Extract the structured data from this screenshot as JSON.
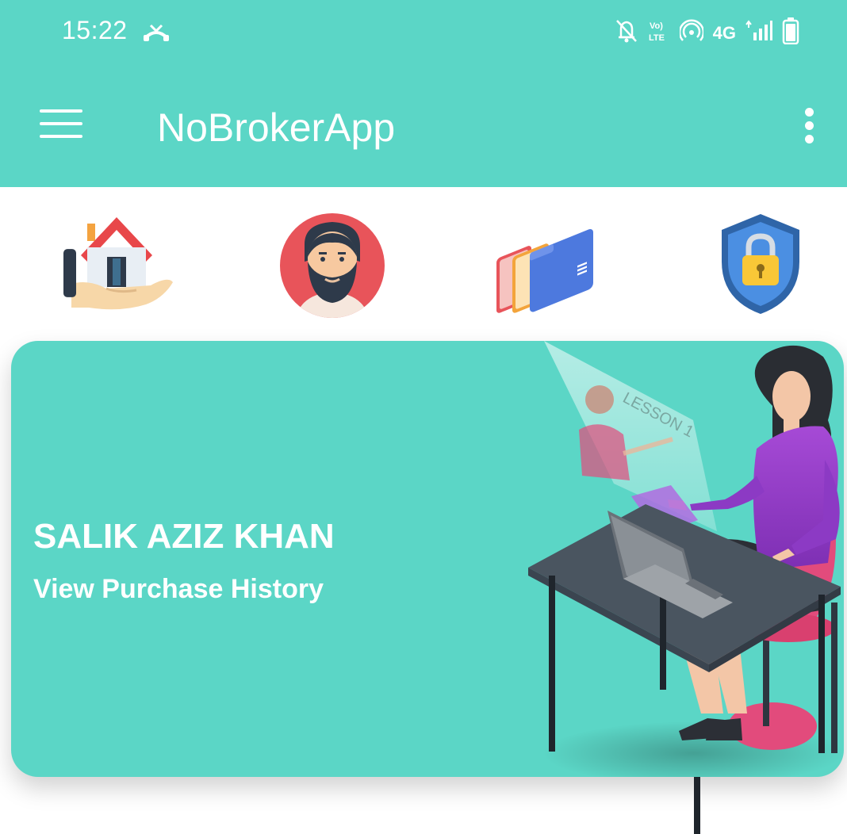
{
  "status_bar": {
    "time": "15:22",
    "network": "4G",
    "icons": [
      "missed-call-icon",
      "bell-off-icon",
      "volte-icon",
      "hotspot-icon",
      "signal-icon",
      "battery-icon"
    ]
  },
  "toolbar": {
    "title": "NoBrokerApp",
    "menu_icon": "hamburger-icon",
    "overflow_icon": "more-vert-icon"
  },
  "quick_actions": [
    {
      "icon": "house-in-hand-icon"
    },
    {
      "icon": "bearded-man-avatar-icon"
    },
    {
      "icon": "files-folders-icon"
    },
    {
      "icon": "security-shield-lock-icon"
    }
  ],
  "profile_card": {
    "name": "SALIK AZIZ KHAN",
    "link_label": "View Purchase History",
    "illustration": "woman-at-laptop-illustration"
  },
  "colors": {
    "primary": "#5bd6c6",
    "text_on_primary": "#ffffff"
  }
}
